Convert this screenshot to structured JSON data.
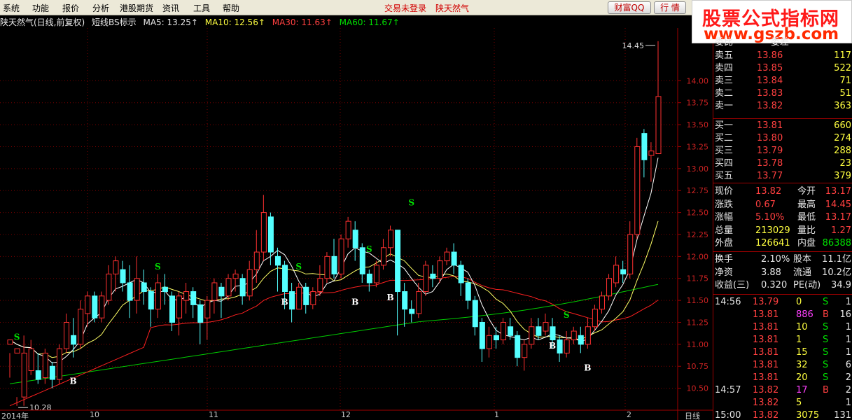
{
  "menubar": {
    "items": [
      "系统",
      "功能",
      "报价",
      "分析",
      "港股期货",
      "资讯",
      "工具",
      "帮助"
    ],
    "status_login": "交易未登录",
    "status_stock": "陕天然气",
    "btn_caifu": "财富QQ",
    "btn_xinqing": "行 情"
  },
  "watermark": {
    "line1": "股票公式指标网",
    "line2": "www.gszb.com"
  },
  "header": {
    "title": "陕天然气(日线,前复权)",
    "indicator": "短线BS标示",
    "ma5": "MA5: 13.25↑",
    "ma10": "MA10: 12.56↑",
    "ma30": "MA30: 11.63↑",
    "ma60": "MA60: 11.67↑"
  },
  "side_panel": {
    "top_row": {
      "a": "委比",
      "b": "委差"
    },
    "asks": [
      {
        "label": "卖五",
        "price": "13.86",
        "vol": "117"
      },
      {
        "label": "卖四",
        "price": "13.85",
        "vol": "522"
      },
      {
        "label": "卖三",
        "price": "13.84",
        "vol": "71"
      },
      {
        "label": "卖二",
        "price": "13.83",
        "vol": "51"
      },
      {
        "label": "卖一",
        "price": "13.82",
        "vol": "363"
      }
    ],
    "bids": [
      {
        "label": "买一",
        "price": "13.81",
        "vol": "660"
      },
      {
        "label": "买二",
        "price": "13.80",
        "vol": "274"
      },
      {
        "label": "买三",
        "price": "13.79",
        "vol": "288"
      },
      {
        "label": "买四",
        "price": "13.78",
        "vol": "23"
      },
      {
        "label": "买五",
        "price": "13.77",
        "vol": "379"
      }
    ],
    "quote": [
      {
        "l1": "现价",
        "v1": "13.82",
        "l2": "今开",
        "v2": "13.17"
      },
      {
        "l1": "涨跌",
        "v1": "0.67",
        "l2": "最高",
        "v2": "14.45"
      },
      {
        "l1": "涨幅",
        "v1": "5.10%",
        "l2": "最低",
        "v2": "13.17"
      },
      {
        "l1": "总量",
        "v1": "213029",
        "l2": "量比",
        "v2": "1.27"
      },
      {
        "l1": "外盘",
        "v1": "126641",
        "l2": "内盘",
        "v2": "86388"
      }
    ],
    "fund": [
      {
        "l1": "换手",
        "v1": "2.10%",
        "l2": "股本",
        "v2": "11.1亿"
      },
      {
        "l1": "净资",
        "v1": "3.88",
        "l2": "流通",
        "v2": "10.2亿"
      },
      {
        "l1": "收益(三)",
        "v1": "0.320",
        "l2": "PE(动)",
        "v2": "34.9"
      }
    ],
    "ticks": [
      {
        "time": "14:56",
        "price": "13.79",
        "vol": "0",
        "side": "S",
        "n": "1"
      },
      {
        "time": "",
        "price": "13.81",
        "vol": "886",
        "side": "B",
        "n": "16"
      },
      {
        "time": "",
        "price": "13.81",
        "vol": "10",
        "side": "S",
        "n": "1"
      },
      {
        "time": "",
        "price": "13.81",
        "vol": "1",
        "side": "S",
        "n": "1"
      },
      {
        "time": "",
        "price": "13.81",
        "vol": "15",
        "side": "S",
        "n": "1"
      },
      {
        "time": "",
        "price": "13.81",
        "vol": "32",
        "side": "S",
        "n": "6"
      },
      {
        "time": "",
        "price": "13.81",
        "vol": "20",
        "side": "S",
        "n": "2"
      },
      {
        "time": "14:57",
        "price": "13.82",
        "vol": "17",
        "side": "B",
        "n": "2"
      },
      {
        "time": "",
        "price": "13.82",
        "vol": "5",
        "side": "",
        "n": "1"
      },
      {
        "time": "15:00",
        "price": "13.82",
        "vol": "3075",
        "side": "",
        "n": "131"
      }
    ]
  },
  "x_axis": {
    "labels": [
      "2014年",
      "10",
      "11",
      "12",
      "1",
      "2"
    ],
    "period": "日线"
  },
  "colors": {
    "up": "#ff3030",
    "down": "#54ffff",
    "ma5": "#ffffff",
    "ma10": "#ffff66",
    "ma30": "#ff2020",
    "ma60": "#00cc00"
  },
  "chart_data": {
    "type": "candlestick",
    "title": "陕天然气(日线,前复权)",
    "y_ticks": [
      10.5,
      10.75,
      11.0,
      11.25,
      11.5,
      11.75,
      12.0,
      12.25,
      12.5,
      12.75,
      13.0,
      13.25,
      13.5,
      13.75,
      14.0
    ],
    "y_tick_labels": [
      "10.50",
      "10.75",
      "11.00",
      "11.25",
      "11.50",
      "11.75",
      "12.00",
      "12.25",
      "12.50",
      "12.75",
      "13.00",
      "13.25",
      "13.50",
      "13.75",
      "14.00"
    ],
    "ylim": [
      10.25,
      14.6
    ],
    "annotations": [
      {
        "label": "10.28",
        "value": 10.28
      },
      {
        "label": "14.45",
        "value": 14.45
      }
    ],
    "candles": [
      [
        11.0,
        11.05,
        10.9,
        10.62
      ],
      [
        10.9,
        10.95,
        10.4,
        10.3
      ],
      [
        10.4,
        10.9,
        11.1,
        10.3
      ],
      [
        10.7,
        10.95,
        11.05,
        10.65
      ],
      [
        10.7,
        10.6,
        10.9,
        10.55
      ],
      [
        10.62,
        10.9,
        10.95,
        10.55
      ],
      [
        10.75,
        10.6,
        10.8,
        10.5
      ],
      [
        10.6,
        10.95,
        11.0,
        10.55
      ],
      [
        10.95,
        11.25,
        11.35,
        10.9
      ],
      [
        11.1,
        11.0,
        11.3,
        10.85
      ],
      [
        11.0,
        11.4,
        11.5,
        10.95
      ],
      [
        11.35,
        11.55,
        11.6,
        11.2
      ],
      [
        11.55,
        11.3,
        11.6,
        11.25
      ],
      [
        11.3,
        11.55,
        11.6,
        11.25
      ],
      [
        11.5,
        11.8,
        11.9,
        11.45
      ],
      [
        11.8,
        11.95,
        12.0,
        11.6
      ],
      [
        11.85,
        11.7,
        11.95,
        11.6
      ],
      [
        11.7,
        11.5,
        11.9,
        11.3
      ],
      [
        11.5,
        11.75,
        12.0,
        11.35
      ],
      [
        11.7,
        11.6,
        11.85,
        11.45
      ],
      [
        11.6,
        11.4,
        11.65,
        11.2
      ],
      [
        11.4,
        11.7,
        11.8,
        11.3
      ],
      [
        11.65,
        11.6,
        11.8,
        11.45
      ],
      [
        11.55,
        11.25,
        11.6,
        11.15
      ],
      [
        11.3,
        11.55,
        11.6,
        11.1
      ],
      [
        11.5,
        11.6,
        11.7,
        11.35
      ],
      [
        11.6,
        11.45,
        11.65,
        11.3
      ],
      [
        11.45,
        11.25,
        11.5,
        11.0
      ],
      [
        11.3,
        11.5,
        11.55,
        11.05
      ],
      [
        11.5,
        11.7,
        11.75,
        11.35
      ],
      [
        11.65,
        11.55,
        11.7,
        11.3
      ],
      [
        11.55,
        11.75,
        11.8,
        11.5
      ],
      [
        11.75,
        11.8,
        11.85,
        11.6
      ],
      [
        11.75,
        11.55,
        11.8,
        11.45
      ],
      [
        11.55,
        11.85,
        11.95,
        11.5
      ],
      [
        11.85,
        12.05,
        12.3,
        11.7
      ],
      [
        12.05,
        12.5,
        12.7,
        11.95
      ],
      [
        12.45,
        12.05,
        12.5,
        11.9
      ],
      [
        12.0,
        11.9,
        12.1,
        11.6
      ],
      [
        11.9,
        11.6,
        11.95,
        11.4
      ],
      [
        11.6,
        11.4,
        11.7,
        11.25
      ],
      [
        11.4,
        11.65,
        11.7,
        11.4
      ],
      [
        11.65,
        11.45,
        11.7,
        11.35
      ],
      [
        11.45,
        11.6,
        11.65,
        11.4
      ],
      [
        11.6,
        11.75,
        11.9,
        11.55
      ],
      [
        11.75,
        12.0,
        12.05,
        11.7
      ],
      [
        12.0,
        11.8,
        12.2,
        11.75
      ],
      [
        11.8,
        12.2,
        12.25,
        11.75
      ],
      [
        12.2,
        12.4,
        12.45,
        12.1
      ],
      [
        12.3,
        12.1,
        12.4,
        11.95
      ],
      [
        12.1,
        11.8,
        12.15,
        11.7
      ],
      [
        11.8,
        11.7,
        11.85,
        11.6
      ],
      [
        11.7,
        11.9,
        11.95,
        11.65
      ],
      [
        11.9,
        12.1,
        12.2,
        11.85
      ],
      [
        12.1,
        12.3,
        12.35,
        12.0
      ],
      [
        12.3,
        11.6,
        12.3,
        11.1
      ],
      [
        11.6,
        11.4,
        11.7,
        11.2
      ],
      [
        11.4,
        11.35,
        11.5,
        11.25
      ],
      [
        11.35,
        11.6,
        11.7,
        11.3
      ],
      [
        11.6,
        11.9,
        11.95,
        11.55
      ],
      [
        11.8,
        11.75,
        11.9,
        11.65
      ],
      [
        11.75,
        11.95,
        12.0,
        11.7
      ],
      [
        11.95,
        12.05,
        12.1,
        11.9
      ],
      [
        12.05,
        11.9,
        12.15,
        11.8
      ],
      [
        11.9,
        11.7,
        11.95,
        11.55
      ],
      [
        11.7,
        11.5,
        11.75,
        11.4
      ],
      [
        11.5,
        11.2,
        11.55,
        11.1
      ],
      [
        11.25,
        10.95,
        11.3,
        10.8
      ],
      [
        10.95,
        11.1,
        11.2,
        10.85
      ],
      [
        11.1,
        11.05,
        11.2,
        10.95
      ],
      [
        11.05,
        11.25,
        11.3,
        11.0
      ],
      [
        11.2,
        11.1,
        11.3,
        11.05
      ],
      [
        11.1,
        10.85,
        11.15,
        10.75
      ],
      [
        10.85,
        11.0,
        11.05,
        10.7
      ],
      [
        11.0,
        11.2,
        11.3,
        10.95
      ],
      [
        11.2,
        11.1,
        11.3,
        11.05
      ],
      [
        11.15,
        11.25,
        11.35,
        11.1
      ],
      [
        11.2,
        11.05,
        11.3,
        10.95
      ],
      [
        11.05,
        10.9,
        11.1,
        10.8
      ],
      [
        10.9,
        11.05,
        11.15,
        10.85
      ],
      [
        11.05,
        11.15,
        11.2,
        11.0
      ],
      [
        11.1,
        11.0,
        11.2,
        10.9
      ],
      [
        11.0,
        11.2,
        11.3,
        10.95
      ],
      [
        11.2,
        11.4,
        11.45,
        11.15
      ],
      [
        11.4,
        11.55,
        11.6,
        11.35
      ],
      [
        11.55,
        11.75,
        11.8,
        11.5
      ],
      [
        11.7,
        11.9,
        12.0,
        11.65
      ],
      [
        11.85,
        11.8,
        11.95,
        11.7
      ],
      [
        11.8,
        12.25,
        12.4,
        11.75
      ],
      [
        12.25,
        13.25,
        13.35,
        12.2
      ],
      [
        13.4,
        13.1,
        13.45,
        12.9
      ],
      [
        13.15,
        13.2,
        13.3,
        12.85
      ],
      [
        13.17,
        13.82,
        14.45,
        13.17
      ]
    ],
    "markers": [
      {
        "label": "S",
        "index": 1,
        "value": 11.05
      },
      {
        "label": "B",
        "index": 9,
        "value": 10.55
      },
      {
        "label": "S",
        "index": 21,
        "value": 11.85
      },
      {
        "label": "B",
        "index": 39,
        "value": 11.45
      },
      {
        "label": "S",
        "index": 41,
        "value": 11.85
      },
      {
        "label": "B",
        "index": 49,
        "value": 11.45
      },
      {
        "label": "S",
        "index": 51,
        "value": 12.05
      },
      {
        "label": "B",
        "index": 54,
        "value": 11.5
      },
      {
        "label": "S",
        "index": 57,
        "value": 12.58
      },
      {
        "label": "S",
        "index": 79,
        "value": 11.3
      },
      {
        "label": "B",
        "index": 77,
        "value": 10.95
      },
      {
        "label": "B",
        "index": 82,
        "value": 10.7
      }
    ]
  }
}
